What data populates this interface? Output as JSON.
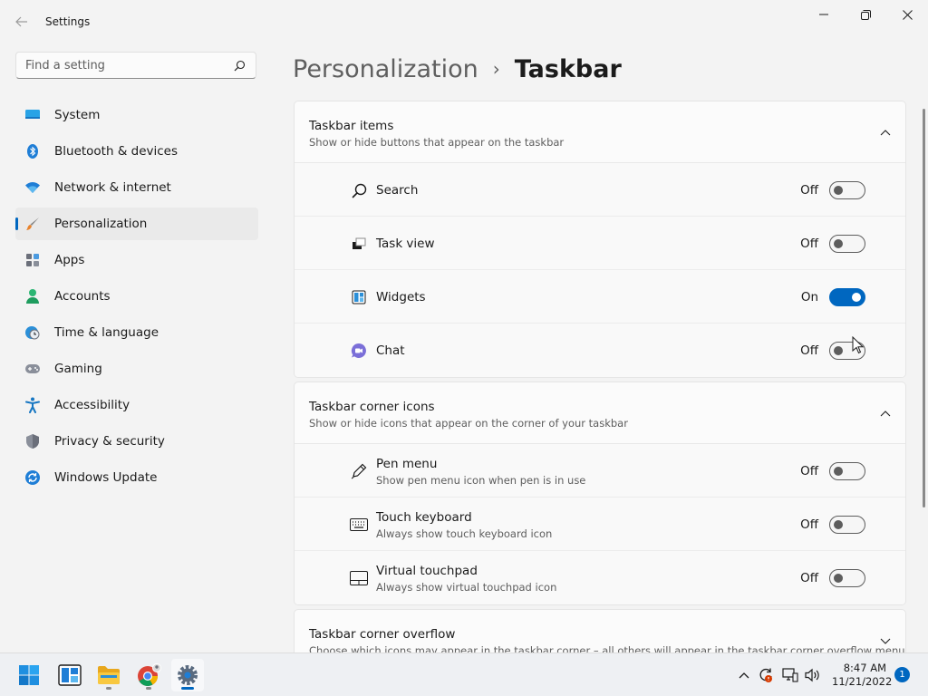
{
  "window": {
    "title": "Settings"
  },
  "search": {
    "placeholder": "Find a setting"
  },
  "sidebar": {
    "items": [
      {
        "label": "System",
        "icon": "monitor-icon",
        "selected": false
      },
      {
        "label": "Bluetooth & devices",
        "icon": "bluetooth-icon",
        "selected": false
      },
      {
        "label": "Network & internet",
        "icon": "wifi-icon",
        "selected": false
      },
      {
        "label": "Personalization",
        "icon": "paintbrush-icon",
        "selected": true
      },
      {
        "label": "Apps",
        "icon": "apps-icon",
        "selected": false
      },
      {
        "label": "Accounts",
        "icon": "person-icon",
        "selected": false
      },
      {
        "label": "Time & language",
        "icon": "clock-globe-icon",
        "selected": false
      },
      {
        "label": "Gaming",
        "icon": "gamepad-icon",
        "selected": false
      },
      {
        "label": "Accessibility",
        "icon": "accessibility-icon",
        "selected": false
      },
      {
        "label": "Privacy & security",
        "icon": "shield-icon",
        "selected": false
      },
      {
        "label": "Windows Update",
        "icon": "update-icon",
        "selected": false
      }
    ]
  },
  "breadcrumb": {
    "parent": "Personalization",
    "separator": "›",
    "current": "Taskbar"
  },
  "sections": {
    "taskbar_items": {
      "title": "Taskbar items",
      "subtitle": "Show or hide buttons that appear on the taskbar",
      "rows": [
        {
          "label": "Search",
          "state": "Off",
          "on": false,
          "icon": "search-icon"
        },
        {
          "label": "Task view",
          "state": "Off",
          "on": false,
          "icon": "task-view-icon"
        },
        {
          "label": "Widgets",
          "state": "On",
          "on": true,
          "icon": "widgets-icon"
        },
        {
          "label": "Chat",
          "state": "Off",
          "on": false,
          "icon": "chat-icon"
        }
      ]
    },
    "corner_icons": {
      "title": "Taskbar corner icons",
      "subtitle": "Show or hide icons that appear on the corner of your taskbar",
      "rows": [
        {
          "label": "Pen menu",
          "sub": "Show pen menu icon when pen is in use",
          "state": "Off",
          "on": false,
          "icon": "pen-icon"
        },
        {
          "label": "Touch keyboard",
          "sub": "Always show touch keyboard icon",
          "state": "Off",
          "on": false,
          "icon": "keyboard-icon"
        },
        {
          "label": "Virtual touchpad",
          "sub": "Always show virtual touchpad icon",
          "state": "Off",
          "on": false,
          "icon": "touchpad-icon"
        }
      ]
    },
    "corner_overflow": {
      "title": "Taskbar corner overflow",
      "subtitle": "Choose which icons may appear in the taskbar corner – all others will appear in the taskbar corner overflow menu"
    }
  },
  "taskbar": {
    "time": "8:47 AM",
    "date": "11/21/2022",
    "notification_count": "1"
  },
  "colors": {
    "accent": "#0067c0",
    "background": "#f3f3f3",
    "card": "#fbfbfb"
  }
}
